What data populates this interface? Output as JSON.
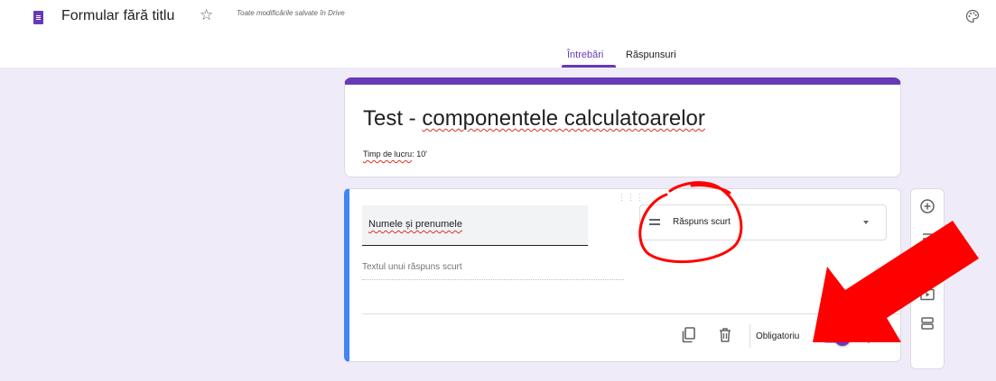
{
  "header": {
    "doc_title": "Formular fără titlu",
    "saved_status": "Toate modificările salvate în Drive",
    "icons": [
      "forms-logo-icon",
      "star-icon",
      "palette-icon"
    ]
  },
  "tabs": [
    {
      "label": "Întrebări",
      "active": true
    },
    {
      "label": "Răspunsuri",
      "active": false
    }
  ],
  "form": {
    "title_plain": "Test - ",
    "title_underlined": "componentele calculatoarelor",
    "description_underlined": "Timp de lucru",
    "description_rest": ": 10'"
  },
  "question": {
    "title": "Numele și prenumele",
    "type": "Răspuns scurt",
    "answer_hint": "Textul unui răspuns scurt",
    "required_label": "Obligatoriu",
    "required": true
  },
  "side_tools": [
    "add-question-icon",
    "import-questions-icon",
    "add-image-icon",
    "add-video-icon",
    "add-section-icon"
  ],
  "colors": {
    "accent": "#673ab7",
    "background": "#f0ebf8",
    "active_border": "#4285f4",
    "annotation": "#ff0000"
  }
}
